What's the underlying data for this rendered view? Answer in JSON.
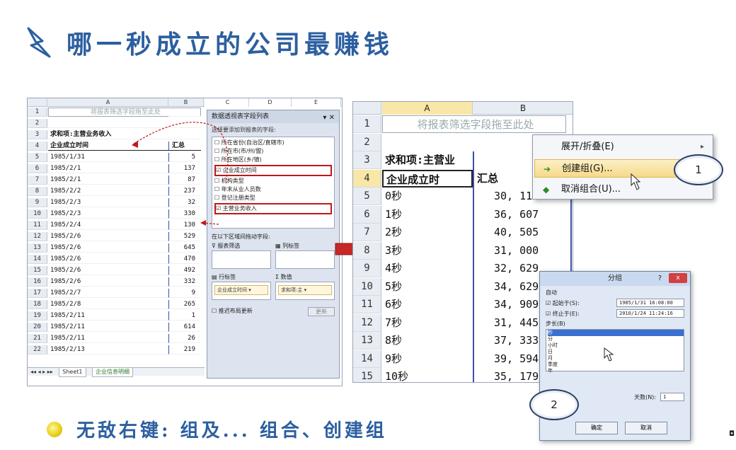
{
  "title": "哪一秒成立的公司最赚钱",
  "left": {
    "col_headers": [
      "A",
      "B",
      "C",
      "D",
      "E"
    ],
    "rows": [
      {
        "n": "1",
        "a": "将报表筛选字段拖至此处",
        "b": ""
      },
      {
        "n": "2",
        "a": "",
        "b": ""
      },
      {
        "n": "3",
        "a": "求和项:主营业务收入",
        "b": ""
      },
      {
        "n": "4",
        "a": "企业成立时间",
        "b": "汇总"
      },
      {
        "n": "5",
        "a": "1985/1/31",
        "b": "5"
      },
      {
        "n": "6",
        "a": "1985/2/1",
        "b": "137"
      },
      {
        "n": "7",
        "a": "1985/2/1",
        "b": "87"
      },
      {
        "n": "8",
        "a": "1985/2/2",
        "b": "237"
      },
      {
        "n": "9",
        "a": "1985/2/3",
        "b": "32"
      },
      {
        "n": "10",
        "a": "1985/2/3",
        "b": "330"
      },
      {
        "n": "11",
        "a": "1985/2/4",
        "b": "130"
      },
      {
        "n": "12",
        "a": "1985/2/6",
        "b": "529"
      },
      {
        "n": "13",
        "a": "1985/2/6",
        "b": "645"
      },
      {
        "n": "14",
        "a": "1985/2/6",
        "b": "470"
      },
      {
        "n": "15",
        "a": "1985/2/6",
        "b": "492"
      },
      {
        "n": "16",
        "a": "1985/2/6",
        "b": "332"
      },
      {
        "n": "17",
        "a": "1985/2/7",
        "b": "9"
      },
      {
        "n": "18",
        "a": "1985/2/8",
        "b": "265"
      },
      {
        "n": "19",
        "a": "1985/2/11",
        "b": "1"
      },
      {
        "n": "20",
        "a": "1985/2/11",
        "b": "614"
      },
      {
        "n": "21",
        "a": "1985/2/11",
        "b": "26"
      },
      {
        "n": "22",
        "a": "1985/2/13",
        "b": "219"
      }
    ],
    "sheet_tabs": [
      "Sheet1",
      "企业信息明细"
    ],
    "pane": {
      "title": "数据透视表字段列表",
      "choose_label": "选择要添加到报表的字段:",
      "fields": [
        {
          "label": "所在省份(自治区/直辖市)",
          "checked": false
        },
        {
          "label": "所在市(市/州/盟)",
          "checked": false
        },
        {
          "label": "所在地区(乡/镇)",
          "checked": false
        },
        {
          "label": "企业成立时间",
          "checked": true
        },
        {
          "label": "机构类型",
          "checked": false
        },
        {
          "label": "年末从业人员数",
          "checked": false
        },
        {
          "label": "登记注册类型",
          "checked": false
        },
        {
          "label": "主营业务收入",
          "checked": true
        }
      ],
      "drag_label": "在以下区域间拖动字段:",
      "area_filter": "报表筛选",
      "area_columns": "列标签",
      "area_rows": "行标签",
      "area_values": "数值",
      "row_chip": "企业成立时间",
      "value_chip": "求和项:主",
      "defer_label": "推迟布局更新",
      "update_label": "更新"
    }
  },
  "right": {
    "col_headers": [
      "A",
      "B"
    ],
    "rows": [
      {
        "n": "1",
        "a": "将报表筛选字段拖至此处",
        "b": ""
      },
      {
        "n": "2",
        "a": "",
        "b": ""
      },
      {
        "n": "3",
        "a": "求和项:主营业",
        "b": ""
      },
      {
        "n": "4",
        "a": "企业成立时",
        "b": "汇总"
      },
      {
        "n": "5",
        "a": "0秒",
        "b": "30, 11"
      },
      {
        "n": "6",
        "a": "1秒",
        "b": "36, 607"
      },
      {
        "n": "7",
        "a": "2秒",
        "b": "40, 505"
      },
      {
        "n": "8",
        "a": "3秒",
        "b": "31, 000"
      },
      {
        "n": "9",
        "a": "4秒",
        "b": "32, 629"
      },
      {
        "n": "10",
        "a": "5秒",
        "b": "34, 629"
      },
      {
        "n": "11",
        "a": "6秒",
        "b": "34, 909"
      },
      {
        "n": "12",
        "a": "7秒",
        "b": "31, 445"
      },
      {
        "n": "13",
        "a": "8秒",
        "b": "37, 333"
      },
      {
        "n": "14",
        "a": "9秒",
        "b": "39, 594"
      },
      {
        "n": "15",
        "a": "10秒",
        "b": "35, 179"
      }
    ]
  },
  "context_menu": {
    "items": [
      "展开/折叠(E)",
      "创建组(G)...",
      "取消组合(U)..."
    ]
  },
  "callouts": [
    "1",
    "2"
  ],
  "dialog": {
    "title": "分组",
    "help": "?",
    "close": "x",
    "auto_label": "自动",
    "start_label": "起始于(S):",
    "start_value": "1985/1/31 16:08:00",
    "end_label": "终止于(E):",
    "end_value": "2010/1/24 11:24:16",
    "step_label": "步长(B)",
    "step_options": [
      "秒",
      "分",
      "小时",
      "日",
      "月",
      "季度",
      "年"
    ],
    "days_label": "天数(N):",
    "days_value": "1",
    "ok": "确定",
    "cancel": "取消"
  },
  "tip": "无敌右键: 组及... 组合、创建组",
  "colors": {
    "accent": "#2c5fa0",
    "highlight": "#f6d98a",
    "red": "#c01818"
  }
}
